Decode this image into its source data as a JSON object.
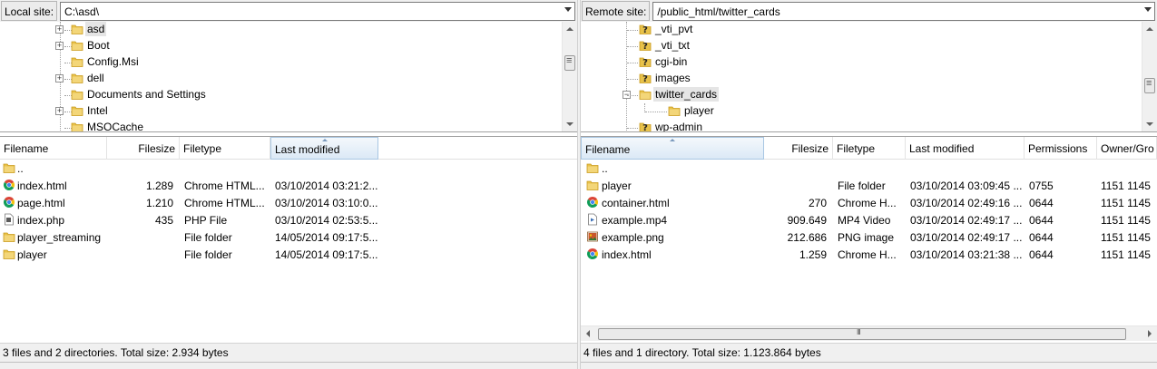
{
  "local": {
    "site_label": "Local site:",
    "site_path": "C:\\asd\\",
    "tree": [
      {
        "label": "asd",
        "expander": "+",
        "selected": true
      },
      {
        "label": "Boot",
        "expander": "+"
      },
      {
        "label": "Config.Msi",
        "expander": ""
      },
      {
        "label": "dell",
        "expander": "+"
      },
      {
        "label": "Documents and Settings",
        "expander": ""
      },
      {
        "label": "Intel",
        "expander": "+"
      },
      {
        "label": "MSOCache",
        "expander": ""
      }
    ],
    "columns": {
      "filename": "Filename",
      "filesize": "Filesize",
      "filetype": "Filetype",
      "modified": "Last modified"
    },
    "files": [
      {
        "name": "..",
        "size": "",
        "type": "",
        "modified": "",
        "icon": "folder-icon"
      },
      {
        "name": "index.html",
        "size": "1.289",
        "type": "Chrome HTML...",
        "modified": "03/10/2014 03:21:2...",
        "icon": "chrome-icon"
      },
      {
        "name": "page.html",
        "size": "1.210",
        "type": "Chrome HTML...",
        "modified": "03/10/2014 03:10:0...",
        "icon": "chrome-icon"
      },
      {
        "name": "index.php",
        "size": "435",
        "type": "PHP File",
        "modified": "03/10/2014 02:53:5...",
        "icon": "php-file-icon"
      },
      {
        "name": "player_streaming",
        "size": "",
        "type": "File folder",
        "modified": "14/05/2014 09:17:5...",
        "icon": "folder-icon"
      },
      {
        "name": "player",
        "size": "",
        "type": "File folder",
        "modified": "14/05/2014 09:17:5...",
        "icon": "folder-icon"
      }
    ],
    "status": "3 files and 2 directories. Total size: 2.934 bytes"
  },
  "remote": {
    "site_label": "Remote site:",
    "site_path": "/public_html/twitter_cards",
    "tree": [
      {
        "label": "_vti_pvt",
        "icon": "unknown"
      },
      {
        "label": "_vti_txt",
        "icon": "unknown"
      },
      {
        "label": "cgi-bin",
        "icon": "unknown"
      },
      {
        "label": "images",
        "icon": "unknown"
      },
      {
        "label": "twitter_cards",
        "icon": "folder",
        "expander": "−",
        "selected": true
      },
      {
        "label": "player",
        "icon": "folder",
        "child": true
      },
      {
        "label": "wp-admin",
        "icon": "unknown"
      }
    ],
    "columns": {
      "filename": "Filename",
      "filesize": "Filesize",
      "filetype": "Filetype",
      "modified": "Last modified",
      "permissions": "Permissions",
      "owner": "Owner/Gro"
    },
    "files": [
      {
        "name": "..",
        "size": "",
        "type": "",
        "modified": "",
        "perms": "",
        "owner": "",
        "icon": "folder-icon"
      },
      {
        "name": "player",
        "size": "",
        "type": "File folder",
        "modified": "03/10/2014 03:09:45 ...",
        "perms": "0755",
        "owner": "1151 1145",
        "icon": "folder-icon"
      },
      {
        "name": "container.html",
        "size": "270",
        "type": "Chrome H...",
        "modified": "03/10/2014 02:49:16 ...",
        "perms": "0644",
        "owner": "1151 1145",
        "icon": "chrome-icon"
      },
      {
        "name": "example.mp4",
        "size": "909.649",
        "type": "MP4 Video",
        "modified": "03/10/2014 02:49:17 ...",
        "perms": "0644",
        "owner": "1151 1145",
        "icon": "video-file-icon"
      },
      {
        "name": "example.png",
        "size": "212.686",
        "type": "PNG image",
        "modified": "03/10/2014 02:49:17 ...",
        "perms": "0644",
        "owner": "1151 1145",
        "icon": "image-file-icon"
      },
      {
        "name": "index.html",
        "size": "1.259",
        "type": "Chrome H...",
        "modified": "03/10/2014 03:21:38 ...",
        "perms": "0644",
        "owner": "1151 1145",
        "icon": "chrome-icon"
      }
    ],
    "status": "4 files and 1 directory. Total size: 1.123.864 bytes"
  },
  "colors": {
    "folder": "#e8c24a",
    "folder_dark": "#c99a1d",
    "chrome_red": "#db4437",
    "chrome_yellow": "#f4c20d",
    "chrome_green": "#0f9d58",
    "chrome_blue": "#4285f4",
    "sort_header": "#dbe9f6"
  }
}
